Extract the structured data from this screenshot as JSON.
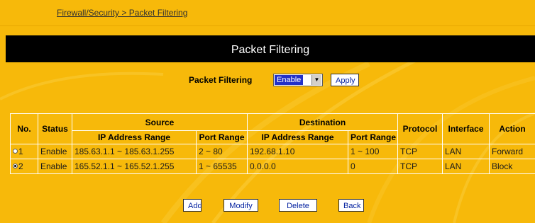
{
  "breadcrumb": "Firewall/Security > Packet Filtering",
  "title": "Packet Filtering",
  "control": {
    "label": "Packet Filtering",
    "selected_value": "Enable",
    "apply_label": "Apply"
  },
  "table": {
    "headers": {
      "no": "No.",
      "status": "Status",
      "source": "Source",
      "destination": "Destination",
      "protocol": "Protocol",
      "interface": "Interface",
      "action": "Action",
      "ip_range": "IP Address Range",
      "port_range": "Port Range"
    },
    "rows": [
      {
        "selected": false,
        "no": "1",
        "status": "Enable",
        "src_ip": "185.63.1.1 ~ 185.63.1.255",
        "src_port": "2 ~ 80",
        "dst_ip": "192.68.1.10",
        "dst_port": "1 ~ 100",
        "protocol": "TCP",
        "interface": "LAN",
        "action": "Forward"
      },
      {
        "selected": true,
        "no": "2",
        "status": "Enable",
        "src_ip": "165.52.1.1 ~ 165.52.1.255",
        "src_port": "1 ~ 65535",
        "dst_ip": "0.0.0.0",
        "dst_port": "0",
        "protocol": "TCP",
        "interface": "LAN",
        "action": "Block"
      }
    ]
  },
  "buttons": {
    "add": "Add",
    "modify": "Modify",
    "delete": "Delete",
    "back": "Back"
  },
  "colors": {
    "background": "#f7b90a",
    "title_bar": "#000000",
    "selected_option": "#2331c8",
    "button_text": "#001f9f"
  },
  "icons": {
    "select_arrow": "chevron-down-icon",
    "row_selector": "radio-button-icon"
  }
}
